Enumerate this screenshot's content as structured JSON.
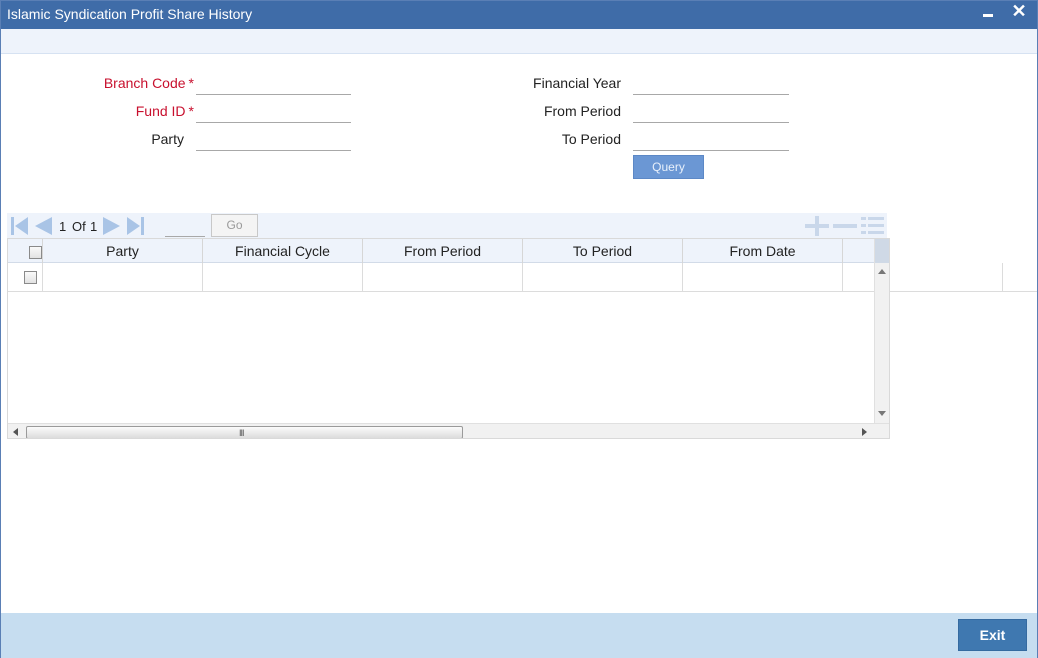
{
  "window": {
    "title": "Islamic Syndication Profit Share History"
  },
  "form": {
    "branch_code_label": "Branch Code",
    "fund_id_label": "Fund ID",
    "party_label": "Party",
    "financial_year_label": "Financial Year",
    "from_period_label": "From Period",
    "to_period_label": "To Period",
    "required_marker": "*",
    "branch_code_value": "",
    "fund_id_value": "",
    "party_value": "",
    "financial_year_value": "",
    "from_period_value": "",
    "to_period_value": "",
    "query_button": "Query"
  },
  "pager": {
    "current_page": "1",
    "of_label": "Of",
    "total_pages": "1",
    "goto_value": "",
    "go_button": "Go"
  },
  "grid": {
    "columns": [
      "Party",
      "Financial Cycle",
      "From Period",
      "To Period",
      "From Date"
    ],
    "rows": [
      {
        "party": "",
        "financial_cycle": "",
        "from_period": "",
        "to_period": "",
        "from_date": ""
      }
    ]
  },
  "footer": {
    "exit_button": "Exit"
  },
  "colors": {
    "titlebar": "#3f6ca8",
    "required": "#c8102e",
    "footer": "#c6ddf0",
    "exit_button": "#3f78b0",
    "query_button": "#6b97d4"
  }
}
